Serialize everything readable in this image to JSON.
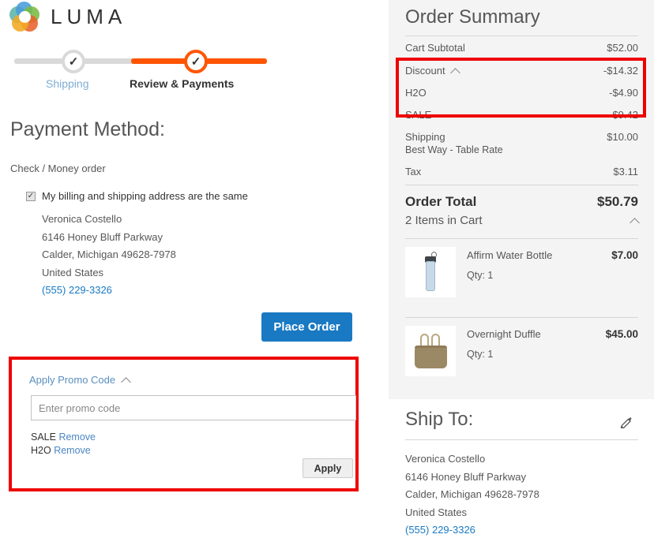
{
  "brand": {
    "name": "LUMA",
    "logo_icon": "luma-logo-icon"
  },
  "progress": {
    "steps": [
      {
        "label": "Shipping",
        "state": "completed",
        "icon": "check-icon"
      },
      {
        "label": "Review & Payments",
        "state": "active",
        "icon": "check-icon"
      }
    ]
  },
  "payment": {
    "title": "Payment Method:",
    "method_name": "Check / Money order",
    "billing_same_label": "My billing and shipping address are the same",
    "billing_same_checked": true,
    "billing_address": {
      "name": "Veronica Costello",
      "street": "6146 Honey Bluff Parkway",
      "city_state_zip": "Calder, Michigan 49628-7978",
      "country": "United States",
      "phone": "(555) 229-3326"
    },
    "place_order_label": "Place Order"
  },
  "promo": {
    "toggle_label": "Apply Promo Code",
    "toggle_icon": "chevron-up-icon",
    "input_value": "",
    "input_placeholder": "Enter promo code",
    "applied_coupons": [
      {
        "code": "SALE",
        "remove_label": "Remove"
      },
      {
        "code": "H2O",
        "remove_label": "Remove"
      }
    ],
    "apply_label": "Apply"
  },
  "order_summary": {
    "title": "Order Summary",
    "rows": [
      {
        "label": "Cart Subtotal",
        "value": "$52.00"
      },
      {
        "label": "Discount",
        "value": "-$14.32",
        "icon": "chevron-up-icon"
      },
      {
        "label": "H2O",
        "value": "-$4.90"
      },
      {
        "label": "SALE",
        "value": "-$9.42"
      },
      {
        "label": "Shipping",
        "value": "$10.00",
        "sub": "Best Way - Table Rate"
      },
      {
        "label": "Tax",
        "value": "$3.11"
      }
    ],
    "total": {
      "label": "Order Total",
      "value": "$50.79"
    }
  },
  "cart": {
    "header": "2 Items in Cart",
    "header_icon": "chevron-up-icon",
    "items": [
      {
        "name": "Affirm Water Bottle",
        "price": "$7.00",
        "qty": "Qty: 1",
        "thumb_icon": "water-bottle-thumb"
      },
      {
        "name": "Overnight Duffle",
        "price": "$45.00",
        "qty": "Qty: 1",
        "thumb_icon": "duffle-bag-thumb"
      }
    ]
  },
  "ship_to": {
    "title": "Ship To:",
    "edit_icon": "pencil-edit-icon",
    "address": {
      "name": "Veronica Costello",
      "street": "6146 Honey Bluff Parkway",
      "city_state_zip": "Calder, Michigan 49628-7978",
      "country": "United States",
      "phone": "(555) 229-3326"
    }
  },
  "annotations": {
    "highlight_color": "#ee0000",
    "boxes": [
      "discount-rows-highlight",
      "promo-code-section-highlight"
    ]
  },
  "colors": {
    "accent_orange": "#ff5501",
    "link_blue": "#1979c3",
    "button_blue": "#1979c3",
    "panel_gray": "#f4f4f4"
  }
}
